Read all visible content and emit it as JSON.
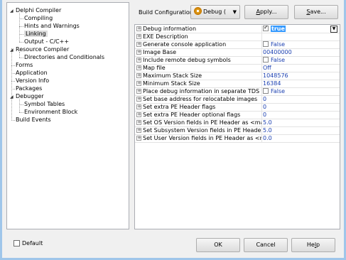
{
  "tree": {
    "items": [
      {
        "label": "Delphi Compiler",
        "expandable": true
      },
      {
        "label": "Compiling"
      },
      {
        "label": "Hints and Warnings"
      },
      {
        "label": "Linking",
        "selected": true
      },
      {
        "label": "Output - C/C++"
      },
      {
        "label": "Resource Compiler",
        "expandable": true
      },
      {
        "label": "Directories and Conditionals"
      },
      {
        "label": "Forms"
      },
      {
        "label": "Application"
      },
      {
        "label": "Version Info"
      },
      {
        "label": "Packages"
      },
      {
        "label": "Debugger",
        "expandable": true
      },
      {
        "label": "Symbol Tables"
      },
      {
        "label": "Environment Block"
      },
      {
        "label": "Build Events"
      }
    ]
  },
  "toolbar": {
    "build_config_label": "Build Configuration:",
    "build_config_value": "Debug ( ▾",
    "build_config_text": "Debug ( ",
    "apply_prefix": "A",
    "apply_rest": "pply...",
    "save_prefix": "S",
    "save_rest": "ave..."
  },
  "properties": [
    {
      "name": "Debug information",
      "value": "true",
      "checkbox": true,
      "checked": true
    },
    {
      "name": "EXE Description",
      "value": ""
    },
    {
      "name": "Generate console application",
      "value": "False",
      "checkbox": true,
      "checked": false
    },
    {
      "name": "Image Base",
      "value": "00400000"
    },
    {
      "name": "Include remote debug symbols",
      "value": "False",
      "checkbox": true,
      "checked": false
    },
    {
      "name": "Map file",
      "value": "Off"
    },
    {
      "name": "Maximum Stack Size",
      "value": "1048576"
    },
    {
      "name": "Minimum Stack Size",
      "value": "16384"
    },
    {
      "name": "Place debug information in separate TDS file",
      "value": "False",
      "checkbox": true,
      "checked": false
    },
    {
      "name": "Set base address for relocatable images",
      "value": "0"
    },
    {
      "name": "Set extra PE Header flags",
      "value": "0"
    },
    {
      "name": "Set extra PE Header optional flags",
      "value": "0"
    },
    {
      "name": "Set OS Version fields in PE Header as <major.minor>",
      "value": "5.0"
    },
    {
      "name": "Set Subsystem Version fields in PE Header as <major.minor>",
      "value": "5.0"
    },
    {
      "name": "Set User Version fields in PE Header as <major.minor>",
      "value": "0.0"
    }
  ],
  "footer": {
    "default_label": "Default",
    "ok_label": "OK",
    "cancel_label": "Cancel",
    "help_prefix": "He",
    "help_u": "l",
    "help_rest": "p"
  },
  "colors": {
    "value_text": "#1a3fb0",
    "selection": "#3399ff",
    "window_border": "#9fc6ea"
  }
}
